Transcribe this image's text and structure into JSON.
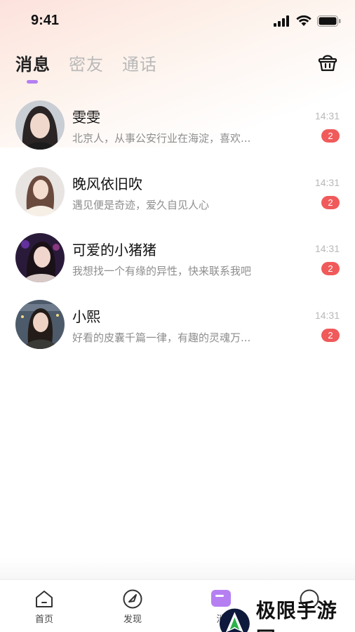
{
  "status": {
    "time": "9:41"
  },
  "tabs": [
    {
      "label": "消息",
      "active": true
    },
    {
      "label": "密友",
      "active": false
    },
    {
      "label": "通话",
      "active": false
    }
  ],
  "messages": [
    {
      "name": "雯雯",
      "preview": "北京人，从事公安行业在海淀，喜欢...",
      "time": "14:31",
      "badge": "2"
    },
    {
      "name": "晚风依旧吹",
      "preview": "遇见便是奇迹，爱久自见人心",
      "time": "14:31",
      "badge": "2"
    },
    {
      "name": "可爱的小猪猪",
      "preview": "我想找一个有缘的异性，快来联系我吧",
      "time": "14:31",
      "badge": "2"
    },
    {
      "name": "小熙",
      "preview": "好看的皮囊千篇一律，有趣的灵魂万...",
      "time": "14:31",
      "badge": "2"
    }
  ],
  "tabbar": {
    "home_label": "首页",
    "discover_label": "发现",
    "message_label": "消"
  },
  "watermark": {
    "text": "极限手游网"
  },
  "colors": {
    "accent": "#b57ff2",
    "badge": "#f05a5a"
  }
}
